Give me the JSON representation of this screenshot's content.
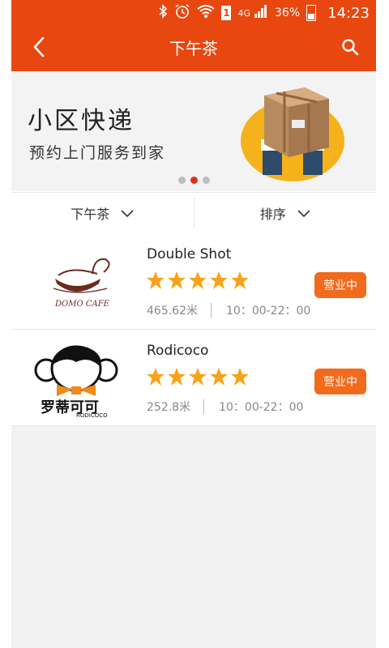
{
  "status_bar": {
    "sim_label": "1",
    "network": "4G",
    "battery": "36%",
    "time": "14:23",
    "bg_color": "#e8470f"
  },
  "header": {
    "title": "下午茶",
    "back_icon": "chevron-left-icon",
    "search_icon": "search-icon",
    "bg_color": "#e8470f"
  },
  "banner": {
    "title": "小区快递",
    "subtitle": "预约上门服务到家",
    "image": "delivery-box-illustration",
    "dots": {
      "count": 3,
      "active_index": 1
    }
  },
  "filters": {
    "category_label": "下午茶",
    "sort_label": "排序"
  },
  "shops": [
    {
      "name": "Double Shot",
      "logo": "domo-cafe-logo",
      "logo_text": "DOMO CAFE",
      "rating": 5,
      "distance": "465.62米",
      "hours": "10：00-22：00",
      "status": "营业中"
    },
    {
      "name": "Rodicoco",
      "logo": "rodicoco-logo",
      "logo_text": "RODICOCO",
      "logo_cn": "罗蒂可可",
      "rating": 5,
      "distance": "252.8米",
      "hours": "10：00-22：00",
      "status": "营业中"
    }
  ],
  "colors": {
    "accent": "#e8470f",
    "badge": "#f26a1c",
    "star": "#f7a31a"
  }
}
